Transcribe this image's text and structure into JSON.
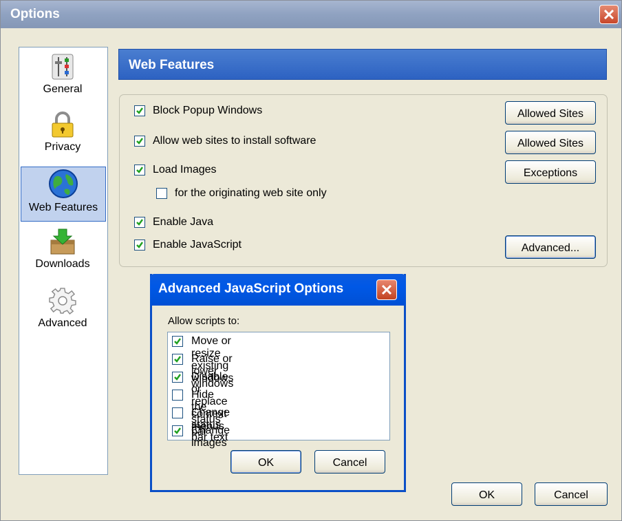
{
  "window": {
    "title": "Options"
  },
  "sidebar": {
    "items": [
      {
        "label": "General",
        "icon": "sliders-icon"
      },
      {
        "label": "Privacy",
        "icon": "padlock-icon"
      },
      {
        "label": "Web Features",
        "icon": "globe-icon",
        "selected": true
      },
      {
        "label": "Downloads",
        "icon": "download-box-icon"
      },
      {
        "label": "Advanced",
        "icon": "gear-icon"
      }
    ]
  },
  "panel": {
    "title": "Web Features",
    "options": [
      {
        "label": "Block Popup Windows",
        "checked": true,
        "button": "Allowed Sites"
      },
      {
        "label": "Allow web sites to install software",
        "checked": true,
        "button": "Allowed Sites"
      },
      {
        "label": "Load Images",
        "checked": true,
        "button": "Exceptions"
      },
      {
        "label": "for the originating web site only",
        "checked": false
      },
      {
        "label": "Enable Java",
        "checked": true
      },
      {
        "label": "Enable JavaScript",
        "checked": true,
        "button": "Advanced..."
      }
    ]
  },
  "dialog": {
    "title": "Advanced JavaScript Options",
    "prompt": "Allow scripts to:",
    "options": [
      {
        "label": "Move or resize existing windows",
        "checked": true
      },
      {
        "label": "Raise or lower windows",
        "checked": true
      },
      {
        "label": "Disable or replace context menus",
        "checked": true
      },
      {
        "label": "Hide the status bar",
        "checked": false
      },
      {
        "label": "Change status bar text",
        "checked": false
      },
      {
        "label": "Change images",
        "checked": true
      }
    ],
    "ok_label": "OK",
    "cancel_label": "Cancel"
  },
  "footer": {
    "ok_label": "OK",
    "cancel_label": "Cancel"
  },
  "colors": {
    "header_blue": "#2d62c2",
    "dialog_titlebar": "#0058e6",
    "selection": "#c1d2ee",
    "check_green": "#21a121"
  }
}
